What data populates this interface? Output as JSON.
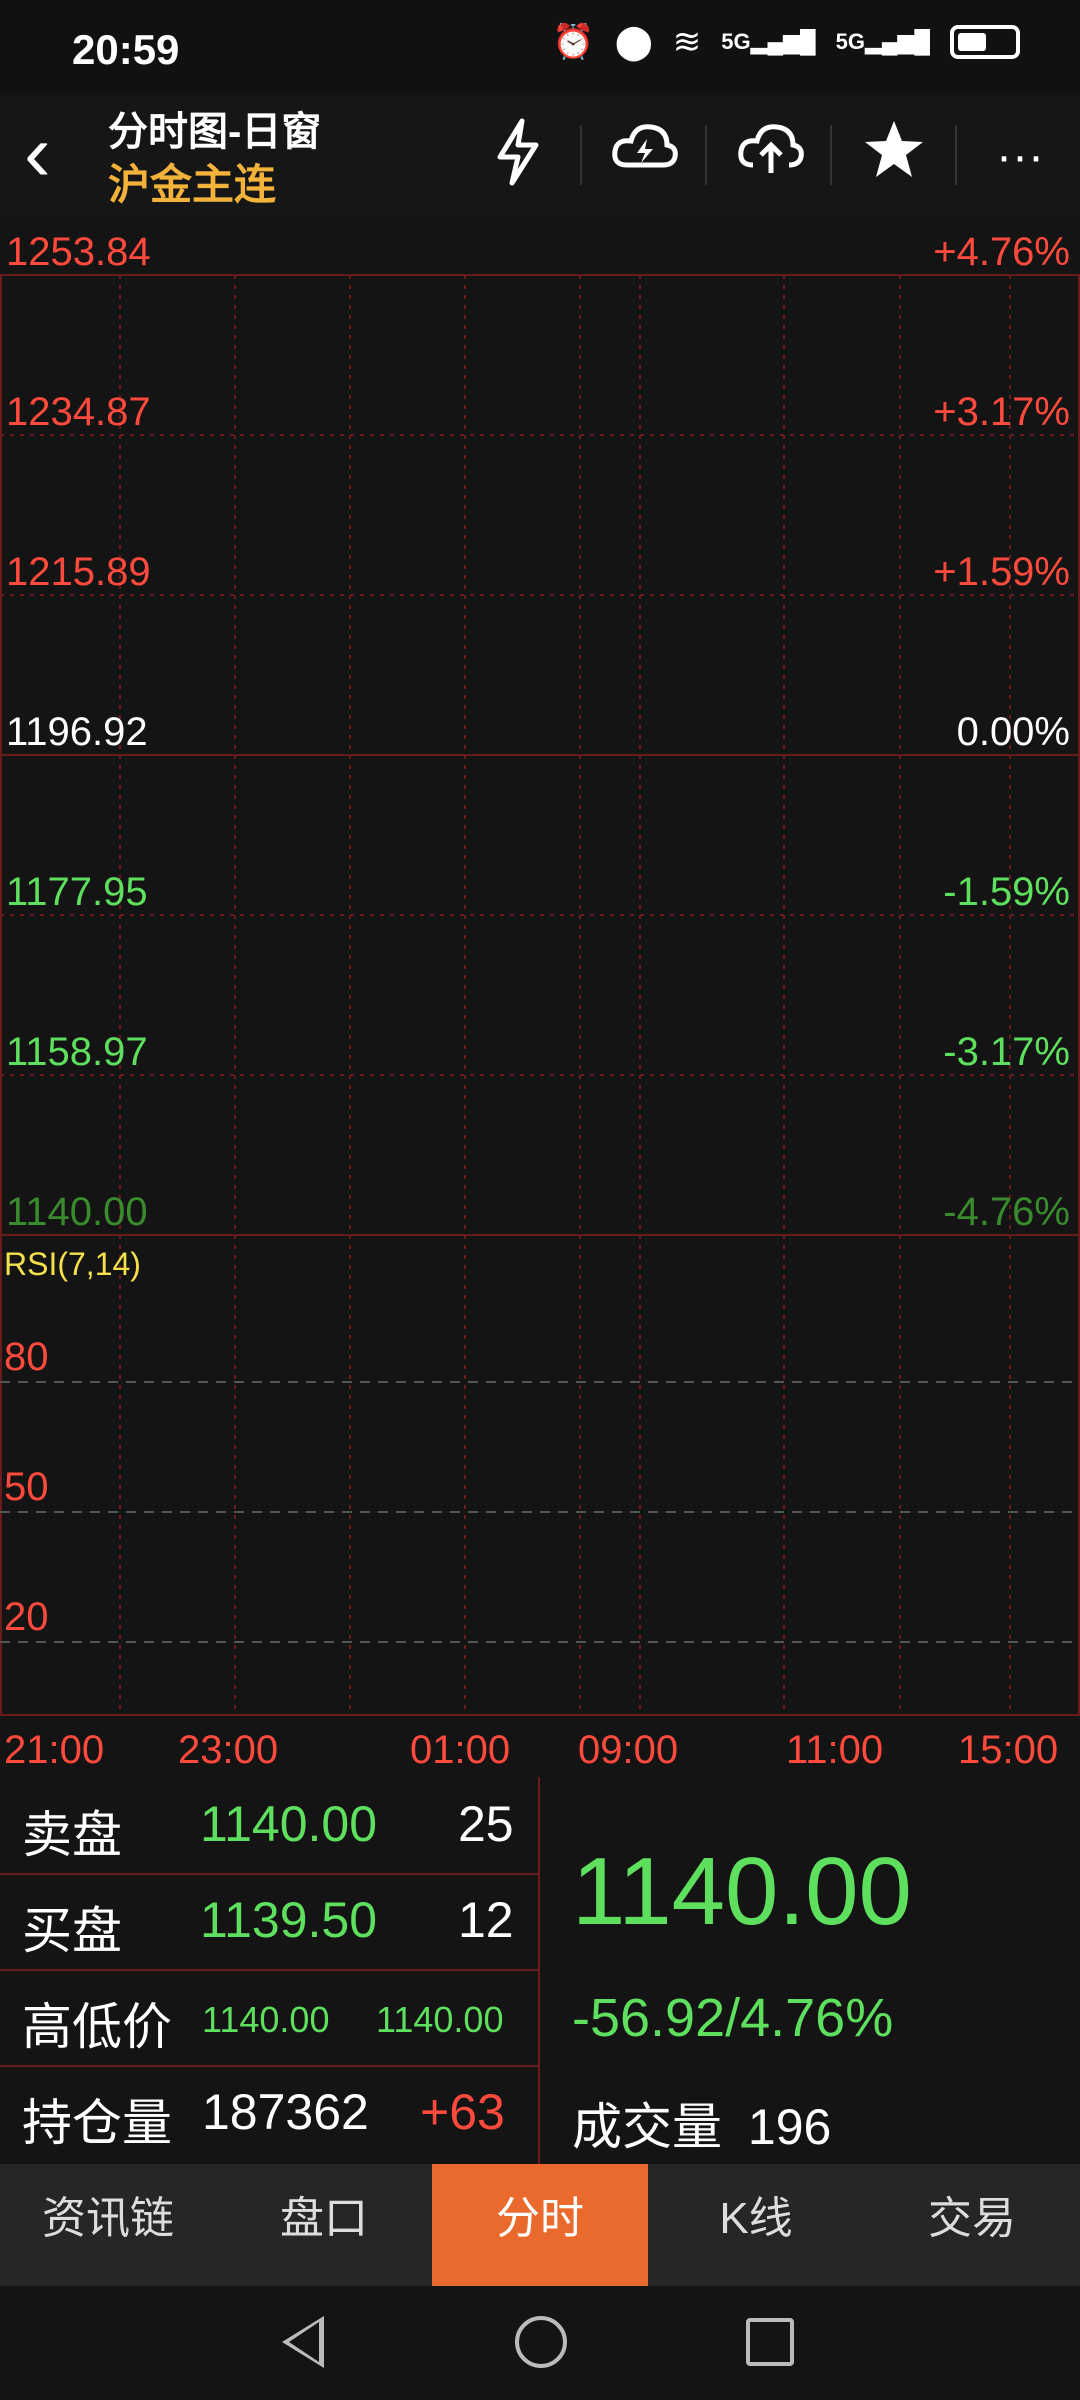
{
  "status": {
    "time": "20:59",
    "net1": "5G",
    "net2": "5G"
  },
  "header": {
    "title": "分时图-日窗",
    "subtitle": "沪金主连"
  },
  "chart": {
    "price_levels": [
      {
        "price": "1253.84",
        "pct": "+4.76%",
        "color": "#ff4a3d"
      },
      {
        "price": "1234.87",
        "pct": "+3.17%",
        "color": "#ff4a3d"
      },
      {
        "price": "1215.89",
        "pct": "+1.59%",
        "color": "#ff4a3d"
      },
      {
        "price": "1196.92",
        "pct": "0.00%",
        "color": "#ffffff"
      },
      {
        "price": "1177.95",
        "pct": "-1.59%",
        "color": "#5ee05e"
      },
      {
        "price": "1158.97",
        "pct": "-3.17%",
        "color": "#5ee05e"
      },
      {
        "price": "1140.00",
        "pct": "-4.76%",
        "color": "#3a8a2e"
      }
    ],
    "rsi_label": "RSI(7,14)",
    "rsi_levels": [
      "80",
      "50",
      "20"
    ],
    "time_labels": [
      "21:00",
      "23:00",
      "01:00",
      "09:00",
      "11:00",
      "15:00"
    ]
  },
  "quote": {
    "sell_label": "卖盘",
    "sell_price": "1140.00",
    "sell_qty": "25",
    "buy_label": "买盘",
    "buy_price": "1139.50",
    "buy_qty": "12",
    "hl_label": "高低价",
    "high": "1140.00",
    "low": "1140.00",
    "oi_label": "持仓量",
    "oi_value": "187362",
    "oi_change": "+63",
    "last_price": "1140.00",
    "change": "-56.92/4.76%",
    "volume_label": "成交量",
    "volume_value": "196"
  },
  "tabs": [
    "资讯链",
    "盘口",
    "分时",
    "K线",
    "交易"
  ],
  "active_tab": "分时"
}
